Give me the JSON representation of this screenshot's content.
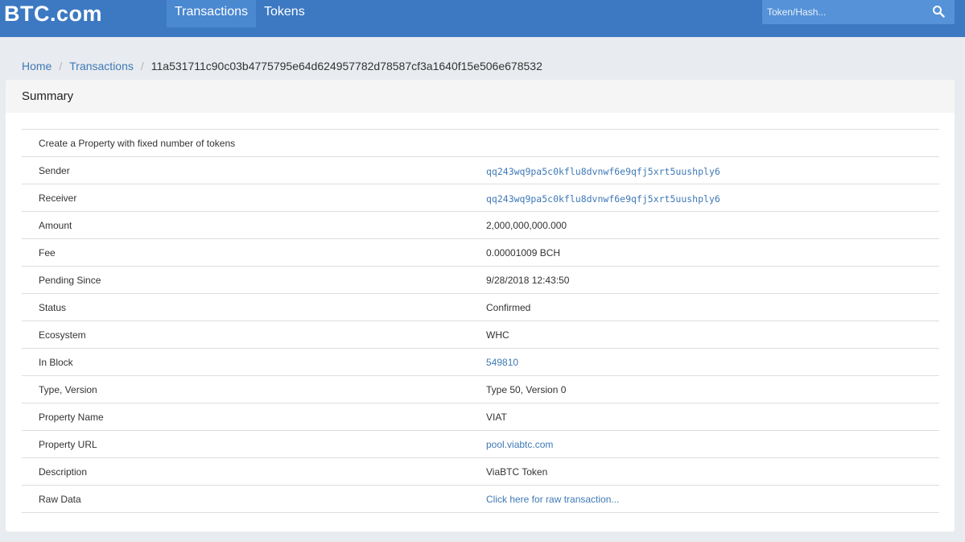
{
  "header": {
    "logo": "BTC.com",
    "nav": [
      {
        "label": "Transactions",
        "active": true
      },
      {
        "label": "Tokens",
        "active": false
      }
    ],
    "search": {
      "placeholder": "Token/Hash..."
    }
  },
  "breadcrumb": {
    "home": "Home",
    "transactions": "Transactions",
    "current": "11a531711c90c03b4775795e64d624957782d78587cf3a1640f15e506e678532"
  },
  "summary": {
    "title": "Summary",
    "description_row": "Create a Property with fixed number of tokens",
    "rows": [
      {
        "label": "Sender",
        "value": "qq243wq9pa5c0kflu8dvnwf6e9qfj5xrt5uushply6"
      },
      {
        "label": "Receiver",
        "value": "qq243wq9pa5c0kflu8dvnwf6e9qfj5xrt5uushply6"
      },
      {
        "label": "Amount",
        "value": "2,000,000,000.000"
      },
      {
        "label": "Fee",
        "value": "0.00001009 BCH"
      },
      {
        "label": "Pending Since",
        "value": "9/28/2018 12:43:50"
      },
      {
        "label": "Status",
        "value": "Confirmed"
      },
      {
        "label": "Ecosystem",
        "value": "WHC"
      },
      {
        "label": "In Block",
        "value": "549810"
      },
      {
        "label": "Type, Version",
        "value": "Type 50, Version 0"
      },
      {
        "label": "Property Name",
        "value": "VIAT"
      },
      {
        "label": "Property URL",
        "value": "pool.viabtc.com"
      },
      {
        "label": "Description",
        "value": "ViaBTC Token"
      },
      {
        "label": "Raw Data",
        "value": "Click here for raw transaction..."
      }
    ]
  }
}
